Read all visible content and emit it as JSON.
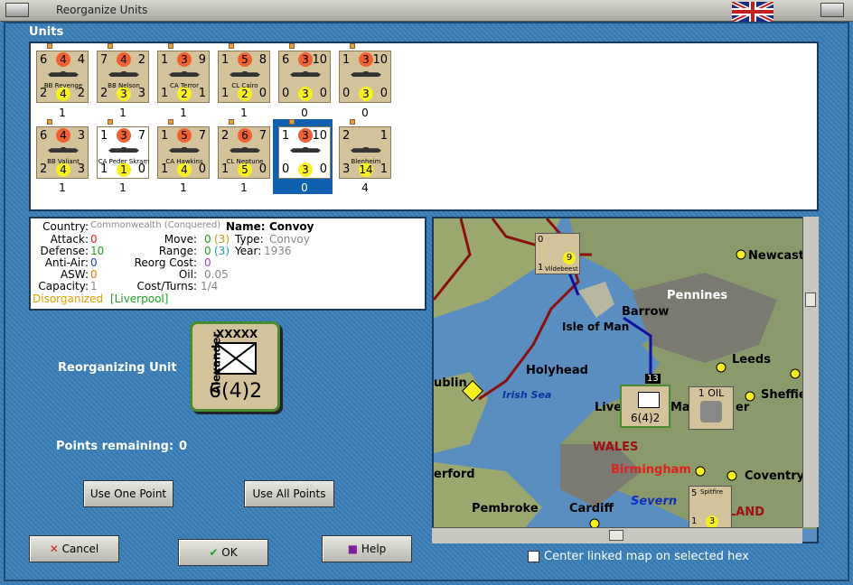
{
  "window": {
    "title": "Reorganize Units"
  },
  "units": {
    "title": "Units",
    "row1": [
      {
        "name": "BB Revenge",
        "tl": "6",
        "tc": "4",
        "tr": "4",
        "bl": "2",
        "bc": "4",
        "br": "2",
        "count": "1"
      },
      {
        "name": "BB Nelson",
        "tl": "7",
        "tc": "4",
        "tr": "2",
        "bl": "2",
        "bc": "3",
        "br": "3",
        "count": "1"
      },
      {
        "name": "CA Terror",
        "tl": "1",
        "tc": "3",
        "tr": "9",
        "bl": "1",
        "bc": "2",
        "br": "1",
        "count": "1"
      },
      {
        "name": "CL Cairo",
        "tl": "1",
        "tc": "5",
        "tr": "8",
        "bl": "1",
        "bc": "2",
        "br": "0",
        "count": "1"
      },
      {
        "name": "",
        "tl": "6",
        "tc": "3",
        "tr": "10",
        "bl": "0",
        "bc": "3",
        "br": "0",
        "count": "0"
      },
      {
        "name": "",
        "tl": "1",
        "tc": "3",
        "tr": "10",
        "bl": "0",
        "bc": "3",
        "br": "0",
        "count": "0"
      }
    ],
    "row2": [
      {
        "name": "BB Valiant",
        "tl": "6",
        "tc": "4",
        "tr": "3",
        "bl": "2",
        "bc": "4",
        "br": "3",
        "count": "1"
      },
      {
        "name": "CA Peder Skram",
        "tl": "1",
        "tc": "3",
        "tr": "7",
        "bl": "1",
        "bc": "1",
        "br": "0",
        "count": "1"
      },
      {
        "name": "CA Hawkins",
        "tl": "1",
        "tc": "5",
        "tr": "7",
        "bl": "1",
        "bc": "4",
        "br": "0",
        "count": "1"
      },
      {
        "name": "CL Neptune",
        "tl": "2",
        "tc": "6",
        "tr": "7",
        "bl": "1",
        "bc": "5",
        "br": "0",
        "count": "1"
      },
      {
        "name": "",
        "tl": "1",
        "tc": "3",
        "tr": "10",
        "bl": "0",
        "bc": "3",
        "br": "0",
        "count": "0"
      },
      {
        "name": "Blenheim",
        "tl": "2",
        "tc": "",
        "tr": "1",
        "bl": "3",
        "bc": "14",
        "br": "1",
        "count": "4"
      }
    ]
  },
  "info": {
    "country_label": "Country:",
    "country_value": "Commonwealth (Conquered)",
    "name_label": "Name:",
    "name_value": "Convoy",
    "attack_label": "Attack:",
    "attack_value": "0",
    "defense_label": "Defense:",
    "defense_value": "10",
    "antiair_label": "Anti-Air:",
    "antiair_value": "0",
    "asw_label": "ASW:",
    "asw_value": "0",
    "capacity_label": "Capacity:",
    "capacity_value": "1",
    "move_label": "Move:",
    "move_value": "0",
    "move_extra": "(3)",
    "type_label": "Type:",
    "type_value": "Convoy",
    "range_label": "Range:",
    "range_value": "0",
    "range_extra": "(3)",
    "year_label": "Year:",
    "year_value": "1936",
    "reorg_label": "Reorg Cost:",
    "reorg_value": "0",
    "oil_label": "Oil:",
    "oil_value": "0.05",
    "costturns_label": "Cost/Turns:",
    "costturns_value": "1/4",
    "status_disorganized": "Disorganized",
    "status_location": "[Liverpool]"
  },
  "reorg": {
    "label": "Reorganizing Unit",
    "hq_size": "XXXXX",
    "hq_name": "Alexander",
    "hq_value": "6(4)2",
    "points_label": "Points remaining:",
    "points_value": "0"
  },
  "buttons": {
    "use_one": "Use One Point",
    "use_all": "Use All Points",
    "cancel": "Cancel",
    "ok": "OK",
    "help": "Help"
  },
  "map": {
    "labels": {
      "newcastle": "Newcast",
      "pennines": "Pennines",
      "barrow": "Barrow",
      "isle_of_man": "Isle of Man",
      "leeds": "Leeds",
      "holyhead": "Holyhead",
      "irish_sea": "Irish Sea",
      "dublin": "ublin",
      "sheffield": "Sheffie",
      "liverpool": "Liver",
      "manchester": "Ma",
      "manchester_end": "er",
      "wales": "WALES",
      "birmingham": "Birmingham",
      "coventry": "Coventry",
      "ford": "erford",
      "pembroke": "Pembroke",
      "cardiff": "Cardiff",
      "severn": "Severn",
      "land": "LAND"
    },
    "vildebeest": {
      "name": "Vildebeest",
      "tl": "0",
      "bc": "9",
      "bl": "1"
    },
    "hq": {
      "id": "13",
      "value": "6(4)2"
    },
    "oil": {
      "label": "1 OIL"
    },
    "spitfire": {
      "name": "Spitfire",
      "tl": "5",
      "bl": "1",
      "bc": "3"
    },
    "linked_checkbox": "Center linked map on selected hex"
  },
  "colors": {
    "accent": "#3a7fb8",
    "attack_red": "#e02020",
    "defense_green": "#20a020",
    "blue": "#2040d0",
    "orange": "#e0a000"
  }
}
